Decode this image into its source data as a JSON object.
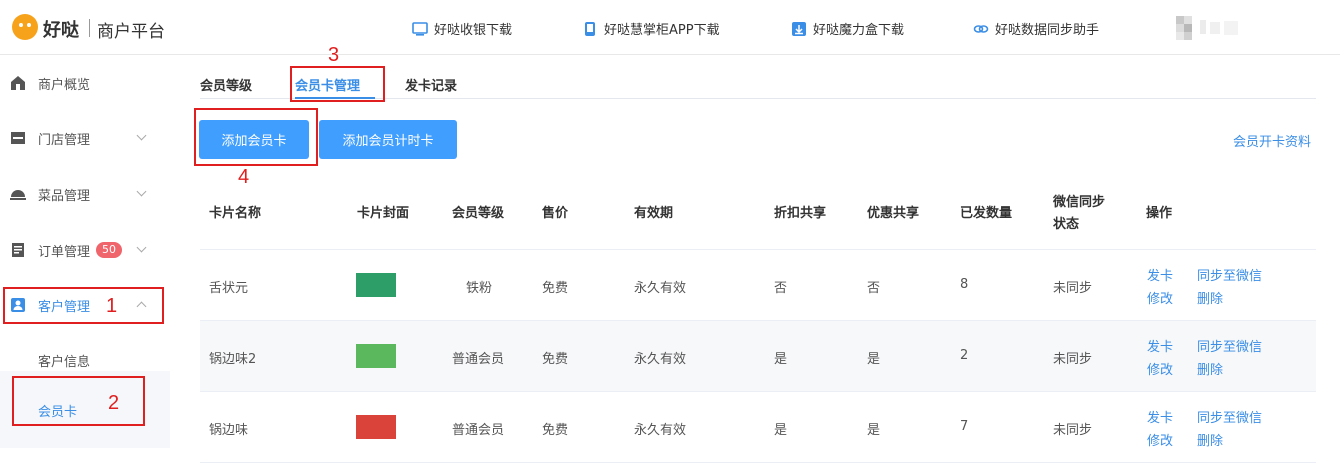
{
  "brand": {
    "name": "好哒",
    "subtitle": "商户平台"
  },
  "top_links": [
    {
      "label": "好哒收银下载",
      "icon": "monitor-icon"
    },
    {
      "label": "好哒慧掌柜APP下载",
      "icon": "phone-icon"
    },
    {
      "label": "好哒魔力盒下载",
      "icon": "download-icon"
    },
    {
      "label": "好哒数据同步助手",
      "icon": "link-icon"
    }
  ],
  "sidebar": {
    "items": [
      {
        "label": "商户概览",
        "icon": "home-icon"
      },
      {
        "label": "门店管理",
        "icon": "store-icon"
      },
      {
        "label": "菜品管理",
        "icon": "dish-icon"
      },
      {
        "label": "订单管理",
        "icon": "order-icon",
        "badge": "50"
      },
      {
        "label": "客户管理",
        "icon": "customer-icon"
      }
    ],
    "sub_items": [
      {
        "label": "客户信息"
      },
      {
        "label": "会员卡"
      }
    ]
  },
  "tabs": [
    {
      "label": "会员等级"
    },
    {
      "label": "会员卡管理"
    },
    {
      "label": "发卡记录"
    }
  ],
  "buttons": {
    "add_card": "添加会员卡",
    "add_timed_card": "添加会员计时卡"
  },
  "link_right": "会员开卡资料",
  "table": {
    "headers": [
      "卡片名称",
      "卡片封面",
      "会员等级",
      "售价",
      "有效期",
      "折扣共享",
      "优惠共享",
      "已发数量",
      "微信同步",
      "状态",
      "操作"
    ],
    "rows": [
      {
        "name": "舌状元",
        "cover": "#2e9e68",
        "level": "铁粉",
        "price": "免费",
        "validity": "永久有效",
        "discount_share": "否",
        "promo_share": "否",
        "issued": "8",
        "sync": "未同步"
      },
      {
        "name": "锅边味2",
        "cover": "#5cb85c",
        "level": "普通会员",
        "price": "免费",
        "validity": "永久有效",
        "discount_share": "是",
        "promo_share": "是",
        "issued": "2",
        "sync": "未同步"
      },
      {
        "name": "锅边味",
        "cover": "#d9433a",
        "level": "普通会员",
        "price": "免费",
        "validity": "永久有效",
        "discount_share": "是",
        "promo_share": "是",
        "issued": "7",
        "sync": "未同步"
      }
    ],
    "actions": {
      "issue": "发卡",
      "sync_wechat": "同步至微信",
      "edit": "修改",
      "delete": "删除"
    }
  },
  "annotations": [
    "1",
    "2",
    "3",
    "4"
  ],
  "colors": {
    "accent": "#409eff",
    "annotation": "#e02020",
    "logo": "#f7a21b",
    "badge": "#f0646c"
  }
}
